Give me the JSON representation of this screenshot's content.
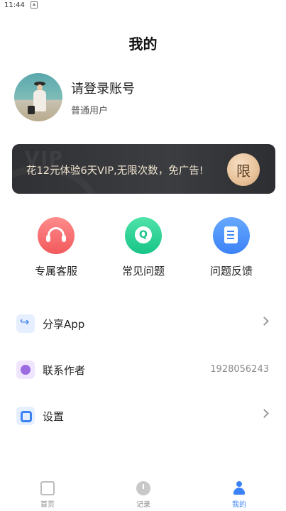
{
  "status_bar": {
    "time": "11:44"
  },
  "header": {
    "title": "我的"
  },
  "profile": {
    "username": "请登录账号",
    "user_type": "普通用户"
  },
  "vip_banner": {
    "text": "花12元体验6天VIP,无限次数，免广告!",
    "badge": "限",
    "watermark": "VIP"
  },
  "quick_actions": [
    {
      "label": "专属客服",
      "icon": "headset-icon",
      "color": "#f2595d"
    },
    {
      "label": "常见问题",
      "icon": "question-bubble-icon",
      "color": "#18c486",
      "glyph": "Q"
    },
    {
      "label": "问题反馈",
      "icon": "feedback-document-icon",
      "color": "#3b82f6"
    }
  ],
  "menu": [
    {
      "label": "分享App",
      "icon": "share-icon"
    },
    {
      "label": "联系作者",
      "icon": "contact-icon",
      "value": "1928056243"
    },
    {
      "label": "设置",
      "icon": "settings-icon"
    }
  ],
  "tab_bar": [
    {
      "label": "首页",
      "icon": "home-icon"
    },
    {
      "label": "记录",
      "icon": "clock-icon"
    },
    {
      "label": "我的",
      "icon": "user-icon",
      "active": true
    }
  ],
  "colors": {
    "accent": "#3b82f6",
    "banner_bg": "#2f3134",
    "banner_text": "#f0e3cf",
    "badge_gold": "#e9c39c"
  }
}
